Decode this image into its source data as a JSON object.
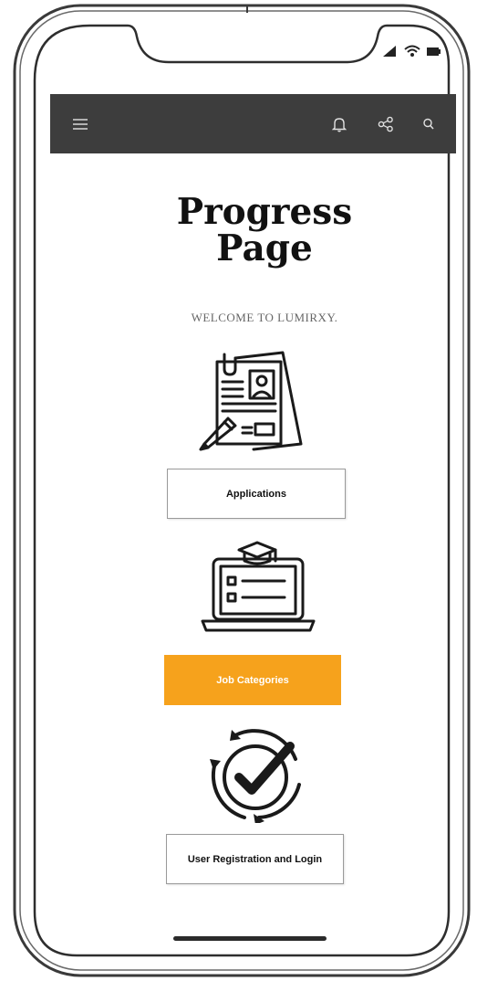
{
  "app_bar": {
    "background": "#3d3d3d",
    "icons": [
      "menu-icon",
      "bell-icon",
      "share-icon",
      "search-icon"
    ]
  },
  "status_bar": {
    "icons": [
      "signal-icon",
      "wifi-icon",
      "battery-icon"
    ]
  },
  "main": {
    "title": "Progress Page",
    "welcome": "WELCOME TO LUMIRXY."
  },
  "sections": [
    {
      "icon": "application-form-icon",
      "button_label": "Applications",
      "style": "outline"
    },
    {
      "icon": "laptop-graduation-icon",
      "button_label": "Job Categories",
      "style": "filled"
    },
    {
      "icon": "circular-check-icon",
      "button_label": "User Registration and Login",
      "style": "outline"
    }
  ],
  "colors": {
    "accent": "#f6a21c",
    "dark": "#3d3d3d"
  }
}
